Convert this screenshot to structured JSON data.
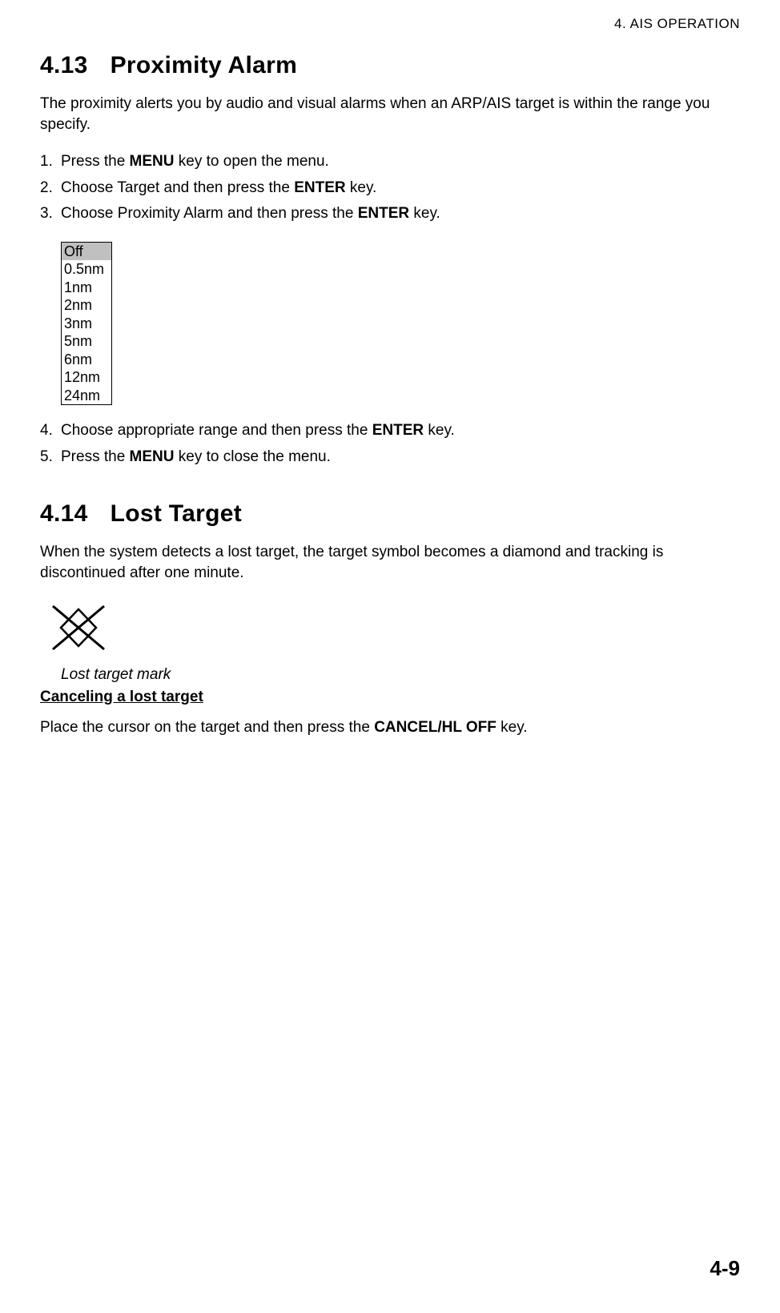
{
  "header": {
    "chapter": "4. AIS OPERATION"
  },
  "section1": {
    "number": "4.13",
    "title": "Proximity Alarm",
    "intro": "The proximity alerts you by audio and visual alarms when an ARP/AIS target is within the range you specify.",
    "step1_a": "Press the ",
    "step1_b": "MENU",
    "step1_c": " key to open the menu.",
    "step2_a": "Choose Target and then press the ",
    "step2_b": "ENTER",
    "step2_c": " key.",
    "step3_a": "Choose Proximity Alarm and then press the ",
    "step3_b": "ENTER",
    "step3_c": " key.",
    "options": {
      "o0": "Off",
      "o1": "0.5nm",
      "o2": "1nm",
      "o3": "2nm",
      "o4": "3nm",
      "o5": "5nm",
      "o6": "6nm",
      "o7": "12nm",
      "o8": "24nm"
    },
    "step4_a": "Choose appropriate range and then press the ",
    "step4_b": "ENTER",
    "step4_c": " key.",
    "step5_a": "Press the ",
    "step5_b": "MENU",
    "step5_c": " key to close the menu."
  },
  "section2": {
    "number": "4.14",
    "title": "Lost Target",
    "intro": "When the system detects a lost target, the target symbol becomes a diamond and tracking is discontinued after one minute.",
    "caption": "Lost target mark",
    "subheading": "Canceling a lost target",
    "cancel_a": "Place the cursor on the target and then press the ",
    "cancel_b": "CANCEL/HL OFF",
    "cancel_c": " key."
  },
  "footer": {
    "page": "4-9"
  }
}
